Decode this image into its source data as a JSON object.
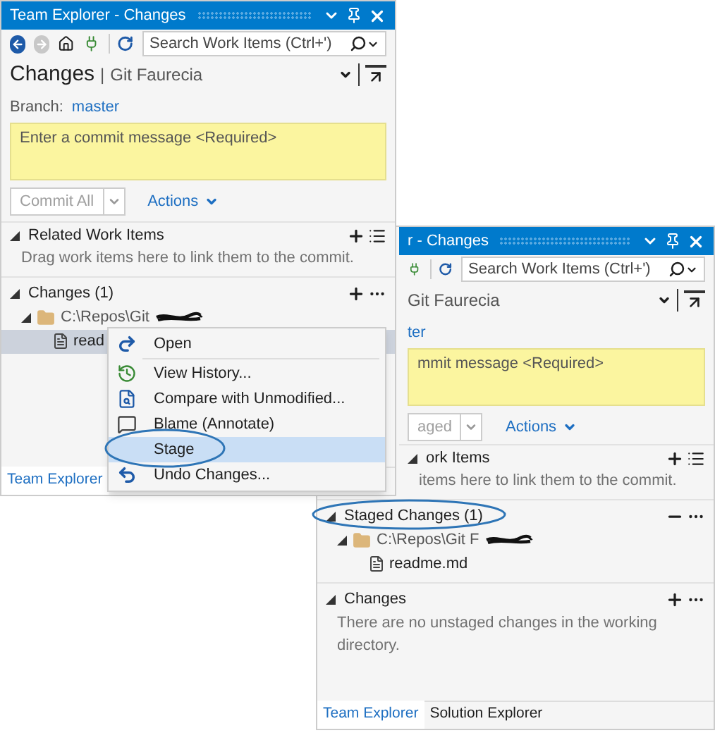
{
  "windows": [
    {
      "title": "Team Explorer - Changes",
      "search": {
        "placeholder": "Search Work Items (Ctrl+')"
      },
      "page_title": "Changes",
      "title_separator": "|",
      "repo": "Git Faurecia",
      "branch_label": "Branch:",
      "branch": "master",
      "commit_message": {
        "placeholder": "Enter a commit message <Required>"
      },
      "commit_button": {
        "label": "Commit All",
        "disabled": true
      },
      "actions": "Actions",
      "sections": [
        {
          "title": "Related Work Items",
          "kind": "work",
          "hint": "Drag work items here to link them to the commit."
        },
        {
          "title": "Changes (1)",
          "kind": "changes",
          "tree": [
            {
              "label": "C:\\Repos\\Git",
              "redacted": true,
              "children": [
                {
                  "label": "read",
                  "selected": true
                }
              ]
            }
          ]
        }
      ],
      "tabs": [
        {
          "label": "Team Explorer",
          "selected": true
        }
      ]
    },
    {
      "title": "r - Changes",
      "search": {
        "placeholder": "Search Work Items (Ctrl+')"
      },
      "repo": "Git Faurecia",
      "branch": "ter",
      "commit_message": {
        "placeholder": "mmit message <Required>"
      },
      "commit_button": {
        "label": "aged",
        "disabled": true
      },
      "actions": "Actions",
      "sections": [
        {
          "title": "ork Items",
          "kind": "work",
          "hint": "items here to link them to the commit."
        },
        {
          "title": "Staged Changes (1)",
          "kind": "staged",
          "tree": [
            {
              "label": "C:\\Repos\\Git F",
              "redacted": true,
              "children": [
                {
                  "label": "readme.md",
                  "selected": false
                }
              ]
            }
          ]
        },
        {
          "title": "Changes",
          "kind": "changes",
          "hint": "There are no unstaged changes in the working directory."
        }
      ],
      "tabs": [
        {
          "label": "Team Explorer",
          "selected": true
        },
        {
          "label": "Solution Explorer",
          "selected": false
        }
      ]
    }
  ],
  "context_menu": {
    "items": [
      {
        "label": "Open",
        "kind": "open",
        "selected": false
      },
      {
        "label": "View History...",
        "kind": "history",
        "selected": false
      },
      {
        "label": "Compare with Unmodified...",
        "kind": "compare",
        "selected": false
      },
      {
        "label": "Blame (Annotate)",
        "kind": "blame",
        "selected": false
      },
      {
        "label": "Stage",
        "kind": "stage",
        "selected": true
      },
      {
        "label": "Undo Changes...",
        "kind": "undo",
        "selected": false
      }
    ]
  }
}
